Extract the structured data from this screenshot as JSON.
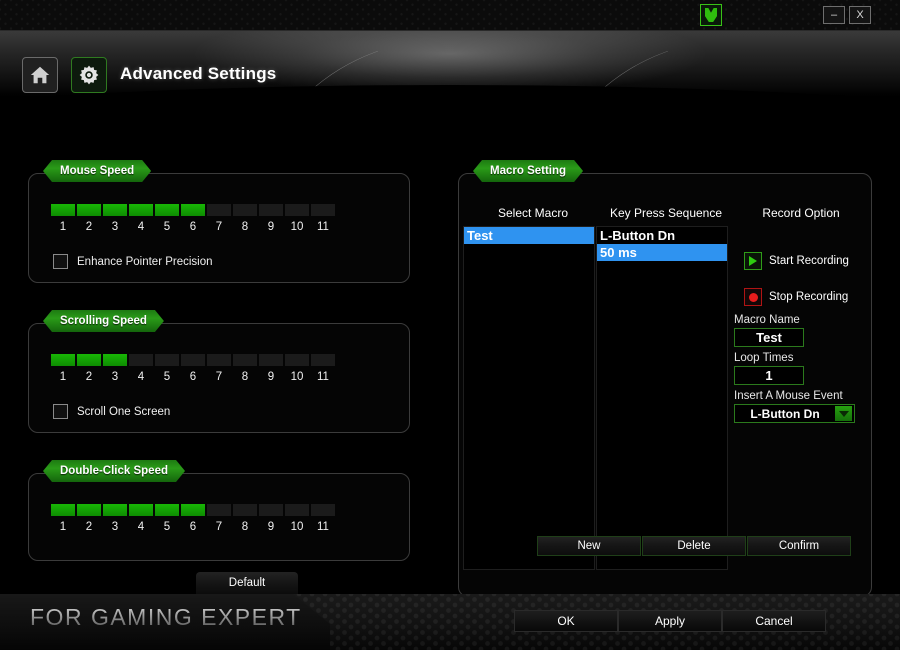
{
  "window": {
    "logo_icon": "brand-logo-icon",
    "minimize_label": "–",
    "close_label": "X"
  },
  "header": {
    "title": "Advanced Settings",
    "home_icon": "home-icon",
    "gear_icon": "gear-icon"
  },
  "mouse_speed": {
    "tab_label": "Mouse Speed",
    "ticks": [
      "1",
      "2",
      "3",
      "4",
      "5",
      "6",
      "7",
      "8",
      "9",
      "10",
      "11"
    ],
    "segments_total": 11,
    "value": 6,
    "checkbox_label": "Enhance Pointer Precision",
    "checkbox_checked": false
  },
  "scrolling_speed": {
    "tab_label": "Scrolling Speed",
    "ticks": [
      "1",
      "2",
      "3",
      "4",
      "5",
      "6",
      "7",
      "8",
      "9",
      "10",
      "11"
    ],
    "segments_total": 11,
    "value": 3,
    "checkbox_label": "Scroll One Screen",
    "checkbox_checked": false
  },
  "double_click_speed": {
    "tab_label": "Double-Click Speed",
    "ticks": [
      "1",
      "2",
      "3",
      "4",
      "5",
      "6",
      "7",
      "8",
      "9",
      "10",
      "11"
    ],
    "segments_total": 11,
    "value": 6
  },
  "default_button_label": "Default",
  "macro": {
    "tab_label": "Macro Setting",
    "select_macro_header": "Select Macro",
    "key_press_header": "Key Press Sequence",
    "record_option_header": "Record Option",
    "macro_list": [
      {
        "label": "Test",
        "selected": true
      }
    ],
    "key_sequence": [
      {
        "label": "L-Button   Dn",
        "selected": false
      },
      {
        "label": "50 ms",
        "selected": true
      }
    ],
    "start_recording_label": "Start Recording",
    "stop_recording_label": "Stop Recording",
    "start_icon": "play-icon",
    "stop_icon": "record-stop-icon",
    "macro_name_label": "Macro Name",
    "macro_name_value": "Test",
    "loop_times_label": "Loop Times",
    "loop_times_value": "1",
    "insert_event_label": "Insert A Mouse Event",
    "insert_event_value": "L-Button   Dn",
    "buttons": {
      "new": "New",
      "delete": "Delete",
      "confirm": "Confirm"
    }
  },
  "footer": {
    "brand": "FOR GAMING EXPERT",
    "ok": "OK",
    "apply": "Apply",
    "cancel": "Cancel"
  },
  "colors": {
    "accent_green": "#18b705",
    "selection_blue": "#2f93f0",
    "record_red": "#e81c1c"
  }
}
